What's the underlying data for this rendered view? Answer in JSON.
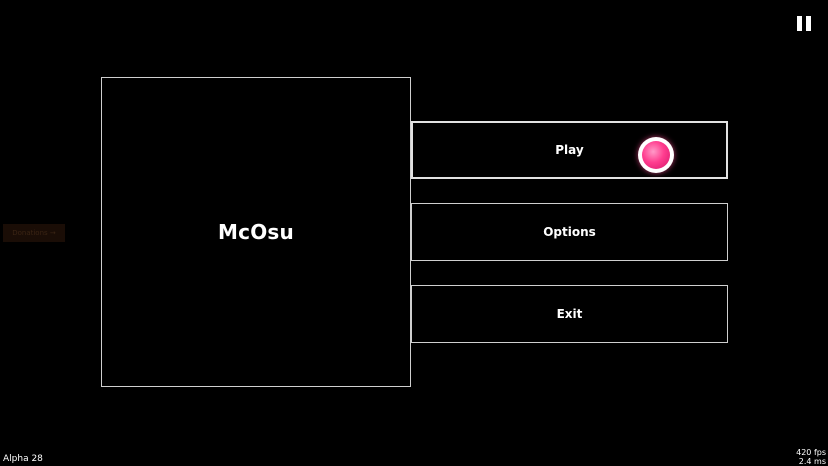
{
  "app": {
    "title": "McOsu"
  },
  "menu": {
    "play_label": "Play",
    "options_label": "Options",
    "exit_label": "Exit"
  },
  "overlay": {
    "pause_icon": "pause-icon",
    "cursor_icon": "cursor-icon",
    "donate_label": "Donations →"
  },
  "status": {
    "version": "Alpha 28",
    "fps": "420 fps",
    "frame_time": "2.4 ms"
  },
  "colors": {
    "background": "#000000",
    "border": "#cfcfcf",
    "cursor": "#ff3d8f"
  }
}
